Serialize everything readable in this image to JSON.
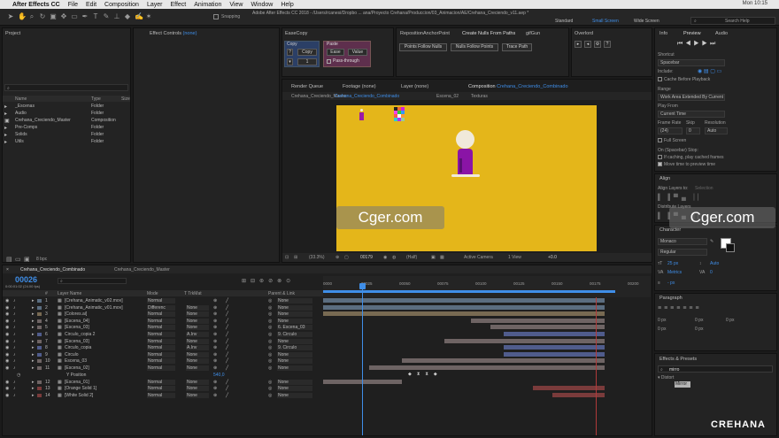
{
  "menubar": {
    "app": "After Effects CC",
    "items": [
      "File",
      "Edit",
      "Composition",
      "Layer",
      "Effect",
      "Animation",
      "View",
      "Window",
      "Help"
    ],
    "clock": "Mon 10:15"
  },
  "toolbar": {
    "snapping": "Snapping",
    "title": "Adobe After Effects CC 2018 - /Users/rcanesi/Dropbo ... ana/Proyecto Crehana/Produccion/03_Animacion/AE/Crehana_Creciendo_v11.aep *",
    "workspaces": [
      "Standard",
      "Small Screen",
      "Wide Screen"
    ],
    "search": "Search Help"
  },
  "project": {
    "title": "Project",
    "bpc": "8 bpc",
    "cols": [
      "Name",
      "Type",
      "Size"
    ],
    "items": [
      {
        "name": "_Escenas",
        "type": "Folder"
      },
      {
        "name": "Audio",
        "type": "Folder"
      },
      {
        "name": "Crehana_Creciendo_Master",
        "type": "Composition"
      },
      {
        "name": "Pre-Comps",
        "type": "Folder"
      },
      {
        "name": "Solids",
        "type": "Folder"
      },
      {
        "name": "Utils",
        "type": "Folder"
      }
    ]
  },
  "effect_controls": {
    "title": "Effect Controls",
    "value": "(none)"
  },
  "easecopy": {
    "title": "EaseCopy",
    "copy_label": "Copy",
    "copy_num": "1",
    "paste_label": "Paste",
    "ease": "Ease",
    "value": "Value",
    "pass": "Pass-through"
  },
  "scripts": {
    "tabs": [
      "RepositionAnchorPoint",
      "Create Nulls From Paths",
      "gifGun"
    ],
    "buttons": [
      "Points Follow Nulls",
      "Nulls Follow Points",
      "Trace Path"
    ]
  },
  "overlord": {
    "title": "Overlord"
  },
  "viewer": {
    "tabs_top": [
      "Render Queue",
      "Footage (none)",
      "Layer (none)"
    ],
    "comp_tab": "Composition",
    "comp_name": "Crehana_Creciendo_Combinado",
    "sub_tabs": [
      "Crehana_Creciendo_Master",
      "Crehana_Creciendo_Combinado",
      "Escena_02",
      "Texturas"
    ],
    "zoom": "(33.3%)",
    "time": "00179",
    "res": "(Half)",
    "camera": "Active Camera",
    "view": "1 View",
    "offset": "+0.0",
    "bg": "#e4b61a"
  },
  "preview": {
    "tabs": [
      "Info",
      "Preview",
      "Audio"
    ],
    "shortcut_label": "Shortcut",
    "shortcut": "Spacebar",
    "include": "Include:",
    "cache": "Cache Before Playback",
    "range_label": "Range",
    "range": "Work Area Extended By Current ...",
    "playfrom_label": "Play From",
    "playfrom": "Current Time",
    "fr_label": "Frame Rate",
    "skip_label": "Skip",
    "res_label": "Resolution",
    "fr": "(24)",
    "skip": "0",
    "resv": "Auto",
    "full": "Full Screen",
    "stop": "On (Spacebar) Stop:",
    "c1": "If caching, play cached frames",
    "c2": "Move time to preview time"
  },
  "align": {
    "title": "Align",
    "layers_to": "Align Layers to:",
    "selection": "Selection",
    "distribute": "Distribute Layers"
  },
  "character": {
    "title": "Character",
    "font": "Monaco",
    "style": "Regular",
    "size": "25 px",
    "lead": "Auto",
    "kern": "Metrics",
    "track": "0",
    "unit": "- px"
  },
  "paragraph": {
    "title": "Paragraph",
    "v": [
      "0 px",
      "0 px",
      "0 px",
      "0 px",
      "0 px"
    ]
  },
  "effects": {
    "title": "Effects & Presets",
    "query": "mirro",
    "cat": "Distort",
    "item": "Mirror"
  },
  "timeline": {
    "tabs": [
      "Crehana_Creciendo_Combinado",
      "Crehana_Creciendo_Master"
    ],
    "timecode": "00026",
    "fps": "0:00:01:02 (24.00 fps)",
    "cols": [
      "#",
      "Layer Name",
      "Mode",
      "T TrkMat",
      "Parent & Link"
    ],
    "ticks": [
      "0000",
      "00025",
      "00050",
      "00075",
      "00100",
      "00125",
      "00150",
      "00175",
      "00200"
    ],
    "sub_label": "Y Position",
    "sub_value": "540,0",
    "layers": [
      {
        "n": "1",
        "name": "[Crehana_Animatic_v02.mov]",
        "mode": "Normal",
        "trk": "",
        "parent": "None",
        "color": "#5b6d80"
      },
      {
        "n": "2",
        "name": "[Crehana_Animatic_v01.mov]",
        "mode": "Differenc",
        "trk": "None",
        "parent": "None",
        "color": "#5b6d80"
      },
      {
        "n": "3",
        "name": "[Colores.ai]",
        "mode": "Normal",
        "trk": "None",
        "parent": "None",
        "color": "#786a52"
      },
      {
        "n": "4",
        "name": "[Escena_04]",
        "mode": "Normal",
        "trk": "None",
        "parent": "None",
        "color": "#6e6464"
      },
      {
        "n": "5",
        "name": "[Escena_03]",
        "mode": "Normal",
        "trk": "None",
        "parent": "6. Escena_03",
        "color": "#6e6464"
      },
      {
        "n": "6",
        "name": "Circulo_copia 2",
        "mode": "Normal",
        "trk": "A.Inv",
        "parent": "9. Circulo",
        "color": "#505c8c"
      },
      {
        "n": "7",
        "name": "[Escena_03]",
        "mode": "Normal",
        "trk": "None",
        "parent": "None",
        "color": "#6e6464"
      },
      {
        "n": "8",
        "name": "Circulo_copia",
        "mode": "Normal",
        "trk": "A.Inv",
        "parent": "9. Circulo",
        "color": "#505c8c"
      },
      {
        "n": "9",
        "name": "Circulo",
        "mode": "Normal",
        "trk": "None",
        "parent": "None",
        "color": "#505c8c"
      },
      {
        "n": "10",
        "name": "Escena_03",
        "mode": "Normal",
        "trk": "None",
        "parent": "None",
        "color": "#6e6464"
      },
      {
        "n": "11",
        "name": "[Escena_02]",
        "mode": "Normal",
        "trk": "None",
        "parent": "None",
        "color": "#6e6464"
      },
      {
        "n": "12",
        "name": "[Escena_01]",
        "mode": "Normal",
        "trk": "None",
        "parent": "None",
        "color": "#6e6464"
      },
      {
        "n": "13",
        "name": "[Orange Solid 1]",
        "mode": "Normal",
        "trk": "None",
        "parent": "None",
        "color": "#7a3b3b"
      },
      {
        "n": "14",
        "name": "[White Solid 2]",
        "mode": "Normal",
        "trk": "None",
        "parent": "None",
        "color": "#7a3b3b"
      }
    ],
    "bars": [
      [
        0,
        0.86
      ],
      [
        0,
        0.86
      ],
      [
        0,
        0.86
      ],
      [
        0.45,
        0.86
      ],
      [
        0.51,
        0.86
      ],
      [
        0.55,
        0.86
      ],
      [
        0.37,
        0.86
      ],
      [
        0.55,
        0.86
      ],
      [
        0.55,
        0.86
      ],
      [
        0.24,
        0.86
      ],
      [
        0.14,
        0.86
      ],
      [
        0,
        0.24
      ],
      [
        0.64,
        0.86
      ],
      [
        0.7,
        0.86
      ]
    ]
  },
  "watermarks": [
    "Cger.com",
    "Cger.com",
    "CREHANA"
  ]
}
